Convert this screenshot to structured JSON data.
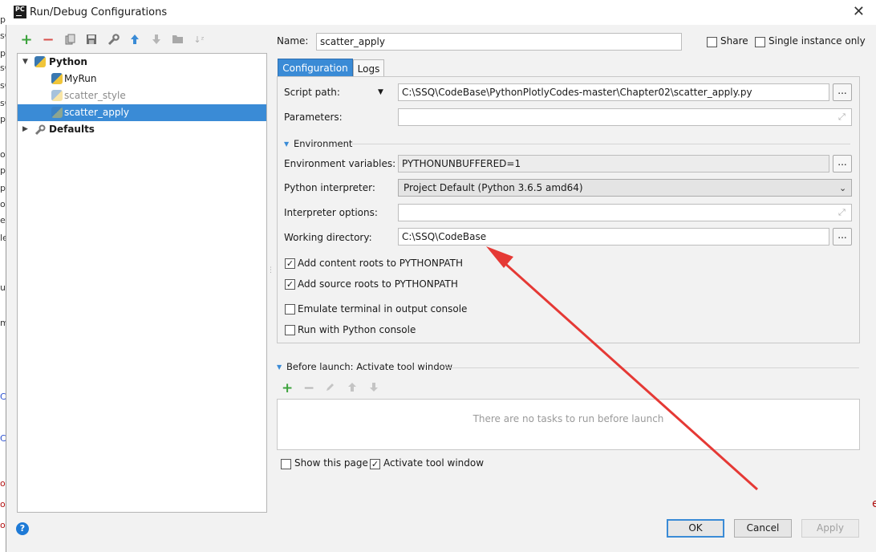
{
  "window": {
    "title": "Run/Debug Configurations",
    "logo_text": "PC"
  },
  "background_fragments": [
    "p",
    "sC",
    "p",
    "sC",
    "sC",
    "sC",
    "p",
    "op",
    "p",
    "p",
    "op",
    "er",
    "le",
    "u",
    "m",
    "C",
    "C",
    "o",
    "o",
    "o",
    "e"
  ],
  "toolbar": {
    "icons": [
      "add-icon",
      "remove-icon",
      "copy-icon",
      "save-icon",
      "wrench-icon",
      "move-up-icon",
      "move-down-icon",
      "folder-icon",
      "sort-icon"
    ]
  },
  "tree": {
    "python": "Python",
    "items": [
      "MyRun",
      "scatter_style",
      "scatter_apply"
    ],
    "defaults": "Defaults"
  },
  "form": {
    "name_label": "Name:",
    "name_value": "scatter_apply",
    "share": "Share",
    "single_instance": "Single instance only",
    "tab_configuration": "Configuration",
    "tab_logs": "Logs",
    "script_path_label": "Script path:",
    "script_path_value": "C:\\SSQ\\CodeBase\\PythonPlotlyCodes-master\\Chapter02\\scatter_apply.py",
    "parameters_label": "Parameters:",
    "environment_section": "Environment",
    "env_vars_label": "Environment variables:",
    "env_vars_value": "PYTHONUNBUFFERED=1",
    "interpreter_label": "Python interpreter:",
    "interpreter_value": "Project Default (Python 3.6.5 amd64)",
    "interp_options_label": "Interpreter options:",
    "working_dir_label": "Working directory:",
    "working_dir_value": "C:\\SSQ\\CodeBase",
    "browse": "...",
    "add_content_roots": "Add content roots to PYTHONPATH",
    "add_source_roots": "Add source roots to PYTHONPATH",
    "emulate_terminal": "Emulate terminal in output console",
    "run_with_console": "Run with Python console",
    "before_launch": "Before launch: Activate tool window",
    "no_tasks": "There are no tasks to run before launch",
    "show_this_page": "Show this page",
    "activate_tool_window": "Activate tool window"
  },
  "buttons": {
    "ok": "OK",
    "cancel": "Cancel",
    "apply": "Apply",
    "help": "?"
  },
  "checks": {
    "share": false,
    "single_instance": false,
    "add_content_roots": true,
    "add_source_roots": true,
    "emulate_terminal": false,
    "run_with_console": false,
    "show_this_page": false,
    "activate_tool_window": true
  },
  "colors": {
    "selection": "#3a8bd6",
    "add_green": "#3da33d",
    "remove_red": "#d9534f",
    "arrow_red": "#e53935"
  }
}
